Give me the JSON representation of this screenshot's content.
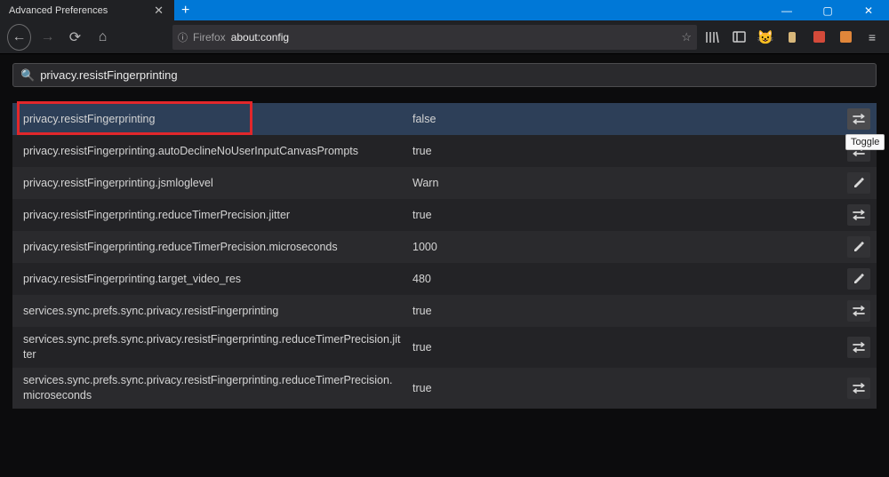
{
  "window": {
    "tab_title": "Advanced Preferences",
    "newtab_glyph": "+",
    "controls": {
      "min": "—",
      "max": "▢",
      "close": "✕"
    }
  },
  "nav": {
    "back": "←",
    "fwd": "→",
    "reload": "⟳",
    "home": "⌂",
    "lock_glyph": "ⓘ",
    "url_host": "Firefox",
    "url_path": "about:config",
    "star": "☆",
    "menu": "≡"
  },
  "search": {
    "icon": "🔍",
    "value": "privacy.resistFingerprinting"
  },
  "tooltip": "Toggle",
  "rows": [
    {
      "pref": "privacy.resistFingerprinting",
      "val": "false",
      "action": "toggle",
      "hl": true,
      "strong": true
    },
    {
      "pref": "privacy.resistFingerprinting.autoDeclineNoUserInputCanvasPrompts",
      "val": "true",
      "action": "toggle"
    },
    {
      "pref": "privacy.resistFingerprinting.jsmloglevel",
      "val": "Warn",
      "action": "edit"
    },
    {
      "pref": "privacy.resistFingerprinting.reduceTimerPrecision.jitter",
      "val": "true",
      "action": "toggle"
    },
    {
      "pref": "privacy.resistFingerprinting.reduceTimerPrecision.microseconds",
      "val": "1000",
      "action": "edit"
    },
    {
      "pref": "privacy.resistFingerprinting.target_video_res",
      "val": "480",
      "action": "edit"
    },
    {
      "pref": "services.sync.prefs.sync.privacy.resistFingerprinting",
      "val": "true",
      "action": "toggle"
    },
    {
      "pref": "services.sync.prefs.sync.privacy.resistFingerprinting.reduceTimerPrecision.jitter",
      "val": "true",
      "action": "toggle"
    },
    {
      "pref": "services.sync.prefs.sync.privacy.resistFingerprinting.reduceTimerPrecision. microseconds",
      "val": "true",
      "action": "toggle"
    }
  ]
}
